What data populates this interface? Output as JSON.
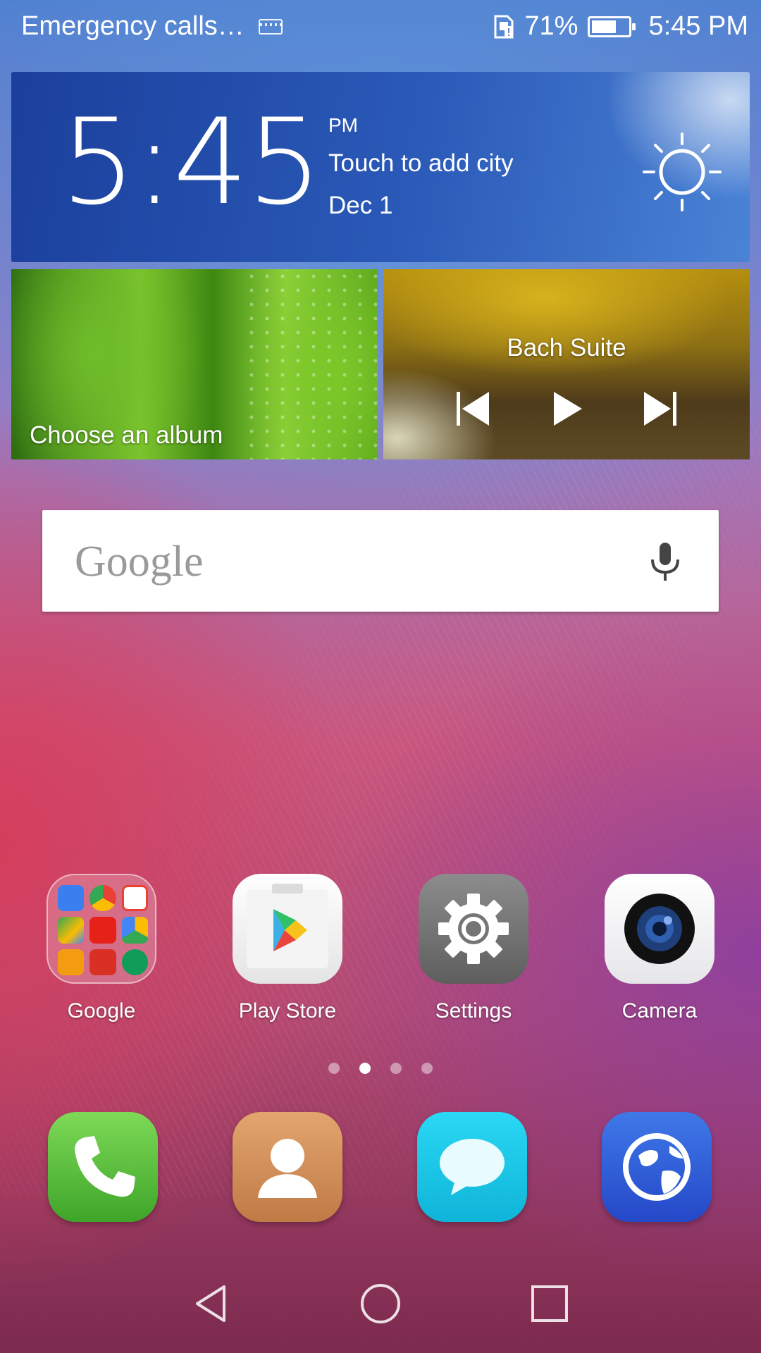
{
  "status_bar": {
    "carrier_text": "Emergency calls…",
    "battery_percent_text": "71%",
    "battery_level": 0.71,
    "time": "5:45 PM",
    "icons": [
      "keyboard-icon",
      "sim-alert-icon",
      "battery-icon"
    ]
  },
  "clock_widget": {
    "time": "5:45",
    "ampm": "PM",
    "city": "Touch to add city",
    "date": "Dec 1",
    "weather_icon": "sun-icon"
  },
  "album_widget": {
    "label": "Choose an album"
  },
  "music_widget": {
    "title": "Bach Suite",
    "controls": [
      "previous-icon",
      "play-icon",
      "next-icon"
    ]
  },
  "search": {
    "logo_text": "Google",
    "mic_icon": "mic-icon"
  },
  "apps": [
    {
      "label": "Google",
      "icon": "google-folder-icon"
    },
    {
      "label": "Play Store",
      "icon": "play-store-icon"
    },
    {
      "label": "Settings",
      "icon": "settings-gear-icon"
    },
    {
      "label": "Camera",
      "icon": "camera-icon"
    }
  ],
  "page_indicator": {
    "count": 4,
    "active_index": 1
  },
  "dock": [
    "phone-icon",
    "contacts-icon",
    "messaging-icon",
    "browser-icon"
  ],
  "nav_bar": [
    "back-icon",
    "home-icon",
    "recents-icon"
  ],
  "colors": {
    "clock_widget_blue": "#2b5ab8",
    "phone_green": "#5cc03a",
    "contacts_orange": "#d3925a",
    "messaging_cyan": "#1ec8e6",
    "browser_blue": "#2f63d8"
  }
}
